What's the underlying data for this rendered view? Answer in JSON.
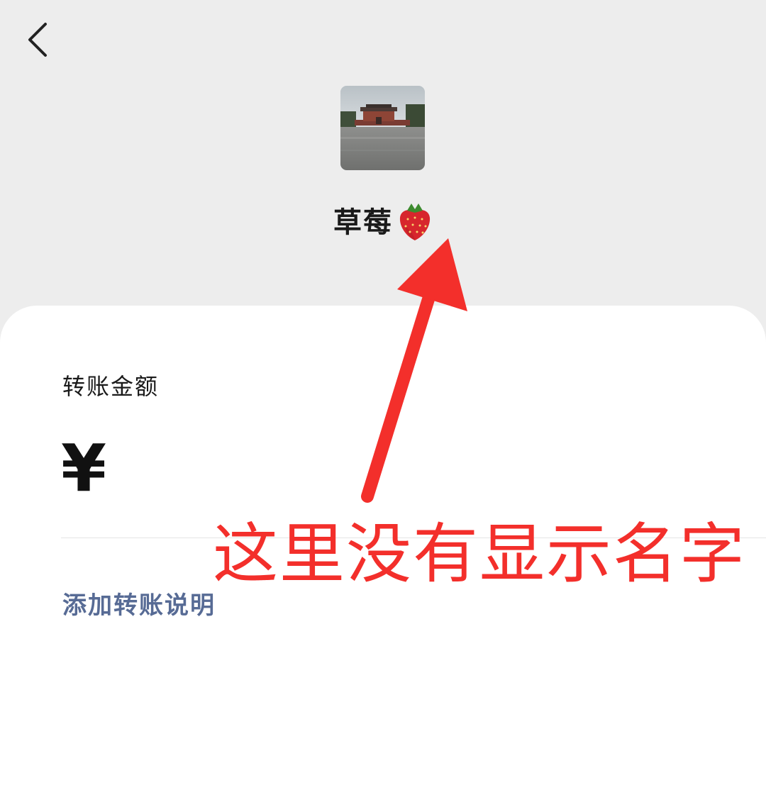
{
  "header": {
    "back_icon": "chevron-left-icon"
  },
  "recipient": {
    "name": "草莓",
    "emoji_icon": "strawberry-icon"
  },
  "transfer": {
    "amount_label": "转账金额",
    "currency_symbol": "¥",
    "amount_value": "",
    "add_note_label": "添加转账说明"
  },
  "annotation": {
    "text": "这里没有显示名字",
    "color": "#f32f2b"
  },
  "colors": {
    "background": "#ededed",
    "card": "#ffffff",
    "link": "#576b95",
    "annotation": "#f32f2b"
  }
}
